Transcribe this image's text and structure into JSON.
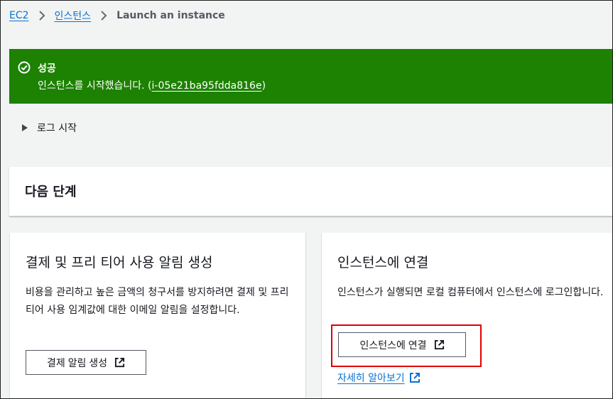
{
  "breadcrumb": {
    "items": [
      {
        "label": "EC2"
      },
      {
        "label": "인스턴스"
      }
    ],
    "current": "Launch an instance"
  },
  "flash": {
    "type": "success",
    "title": "성공",
    "message_prefix": "인스턴스를 시작했습니다. (",
    "instance_id": "i-05e21ba95fdda816e",
    "message_suffix": ")",
    "color": "#1d8102"
  },
  "log": {
    "label": "로그 시작"
  },
  "next_steps": {
    "title": "다음 단계"
  },
  "cards": {
    "billing": {
      "title": "결제 및 프리 티어 사용 알림 생성",
      "description": "비용을 관리하고 높은 금액의 청구서를 방지하려면 결제 및 프리 티어 사용 임계값에 대한 이메일 알림을 설정합니다.",
      "button_label": "결제 알림 생성"
    },
    "connect": {
      "title": "인스턴스에 연결",
      "description": "인스턴스가 실행되면 로컬 컴퓨터에서 인스턴스에 로그인합니다.",
      "button_label": "인스턴스에 연결",
      "learn_more": "자세히 알아보기"
    }
  },
  "colors": {
    "link": "#0972d3",
    "highlight": "#e00000"
  }
}
